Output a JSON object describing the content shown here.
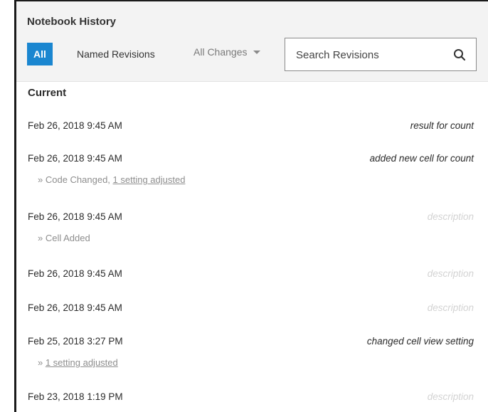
{
  "panel": {
    "title": "Notebook History"
  },
  "tabs": {
    "all_label": "All",
    "named_label": "Named Revisions"
  },
  "filter": {
    "selected": "All Changes"
  },
  "search": {
    "placeholder": "Search Revisions",
    "value": ""
  },
  "section": {
    "current_label": "Current"
  },
  "revisions": [
    {
      "date": "Feb 26, 2018 9:45 AM",
      "description": "result for count",
      "has_description": true,
      "sub_prefix": "",
      "sub_link": ""
    },
    {
      "date": "Feb 26, 2018 9:45 AM",
      "description": "added new cell for count",
      "has_description": true,
      "sub_prefix": "» Code Changed, ",
      "sub_link": "1 setting adjusted"
    },
    {
      "date": "Feb 26, 2018 9:45 AM",
      "description": "description",
      "has_description": false,
      "sub_prefix": "» Cell Added",
      "sub_link": ""
    },
    {
      "date": "Feb 26, 2018 9:45 AM",
      "description": "description",
      "has_description": false,
      "sub_prefix": "",
      "sub_link": ""
    },
    {
      "date": "Feb 26, 2018 9:45 AM",
      "description": "description",
      "has_description": false,
      "sub_prefix": "",
      "sub_link": ""
    },
    {
      "date": "Feb 25, 2018 3:27 PM",
      "description": "changed cell view setting",
      "has_description": true,
      "sub_prefix": "» ",
      "sub_link": "1 setting adjusted"
    },
    {
      "date": "Feb 23, 2018 1:19 PM",
      "description": "description",
      "has_description": false,
      "sub_prefix": "",
      "sub_link": ""
    }
  ],
  "colors": {
    "accent": "#1a86d0",
    "header_bg": "#f3f3f3",
    "placeholder_text": "#d3d3d3"
  }
}
